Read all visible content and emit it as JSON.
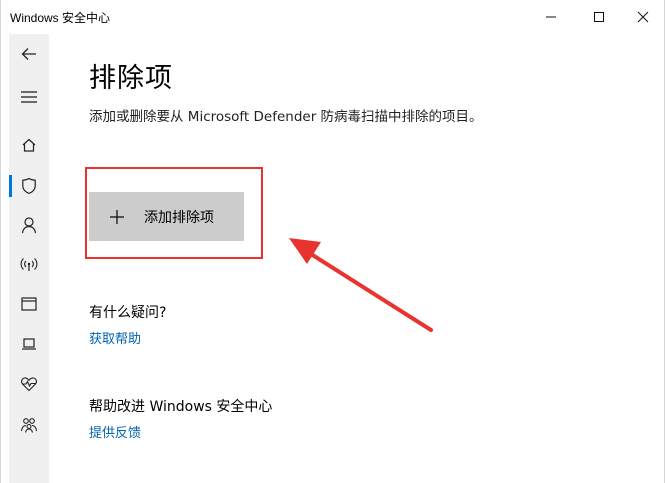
{
  "window": {
    "title": "Windows 安全中心"
  },
  "nav": {
    "items": [
      {
        "icon": "back-arrow-icon"
      },
      {
        "icon": "hamburger-menu-icon"
      },
      {
        "icon": "home-icon"
      },
      {
        "icon": "shield-icon",
        "active": true
      },
      {
        "icon": "person-icon"
      },
      {
        "icon": "wireless-signal-icon"
      },
      {
        "icon": "app-browser-window-icon"
      },
      {
        "icon": "laptop-device-icon"
      },
      {
        "icon": "heart-pulse-icon"
      },
      {
        "icon": "family-icon"
      }
    ],
    "accent": "#0078d7"
  },
  "main": {
    "title": "排除项",
    "description": "添加或删除要从 Microsoft Defender 防病毒扫描中排除的项目。",
    "add_button_label": "添加排除项",
    "questions_heading": "有什么疑问?",
    "questions_link": "获取帮助",
    "improve_heading": "帮助改进 Windows 安全中心",
    "improve_link": "提供反馈"
  },
  "annotation": {
    "highlight_color": "#e8332f"
  }
}
